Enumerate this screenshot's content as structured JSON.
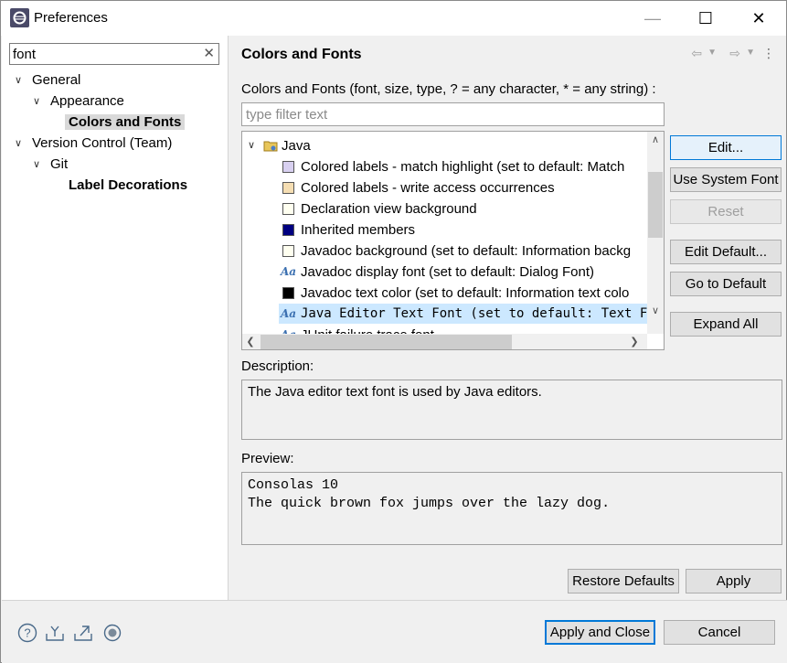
{
  "window": {
    "title": "Preferences",
    "minimize_glyph": "—",
    "maximize_glyph": "☐",
    "close_glyph": "✕"
  },
  "filter": {
    "value": "font",
    "clear_glyph": "✕"
  },
  "tree": {
    "items": [
      {
        "label": "General",
        "expanded": true
      },
      {
        "label": "Appearance",
        "expanded": true
      },
      {
        "label": "Colors and Fonts",
        "selected": true
      },
      {
        "label": "Version Control (Team)",
        "expanded": true
      },
      {
        "label": "Git",
        "expanded": true
      },
      {
        "label": "Label Decorations"
      }
    ]
  },
  "page": {
    "title": "Colors and Fonts",
    "filter_label": "Colors and Fonts (font, size, type, ? = any character, * = any string) :",
    "filter_placeholder": "type filter text",
    "category": "Java",
    "rows": [
      {
        "kind": "color",
        "color": "#d8d0f0",
        "label": "Colored labels - match highlight (set to default: Match"
      },
      {
        "kind": "color",
        "color": "#f5deb3",
        "label": "Colored labels - write access occurrences"
      },
      {
        "kind": "color",
        "color": "#fffff0",
        "label": "Declaration view background"
      },
      {
        "kind": "color",
        "color": "#000080",
        "label": "Inherited members"
      },
      {
        "kind": "color",
        "color": "#fffff0",
        "label": "Javadoc background (set to default: Information backg"
      },
      {
        "kind": "font",
        "icon": "Aa",
        "label": "Javadoc display font (set to default: Dialog Font)"
      },
      {
        "kind": "color",
        "color": "#000000",
        "label": "Javadoc text color (set to default: Information text colo"
      },
      {
        "kind": "font",
        "icon": "Aa",
        "label": "Java Editor Text Font (set to default: Text Fon",
        "selected": true
      },
      {
        "kind": "font",
        "icon": "Aa",
        "label": "JUnit failure trace font"
      }
    ],
    "buttons": {
      "edit": "Edit...",
      "use_system_font": "Use System Font",
      "reset": "Reset",
      "edit_default": "Edit Default...",
      "go_to_default": "Go to Default",
      "expand_all": "Expand All"
    },
    "description_label": "Description:",
    "description_text": "The Java editor text font is used by Java editors.",
    "preview_label": "Preview:",
    "preview_lines": [
      "Consolas 10",
      "The quick brown fox jumps over the lazy dog."
    ],
    "restore_defaults": "Restore Defaults",
    "apply": "Apply"
  },
  "footer": {
    "apply_and_close": "Apply and Close",
    "cancel": "Cancel"
  },
  "colors": {
    "accent": "#0078d7",
    "selection": "#cce8ff"
  }
}
